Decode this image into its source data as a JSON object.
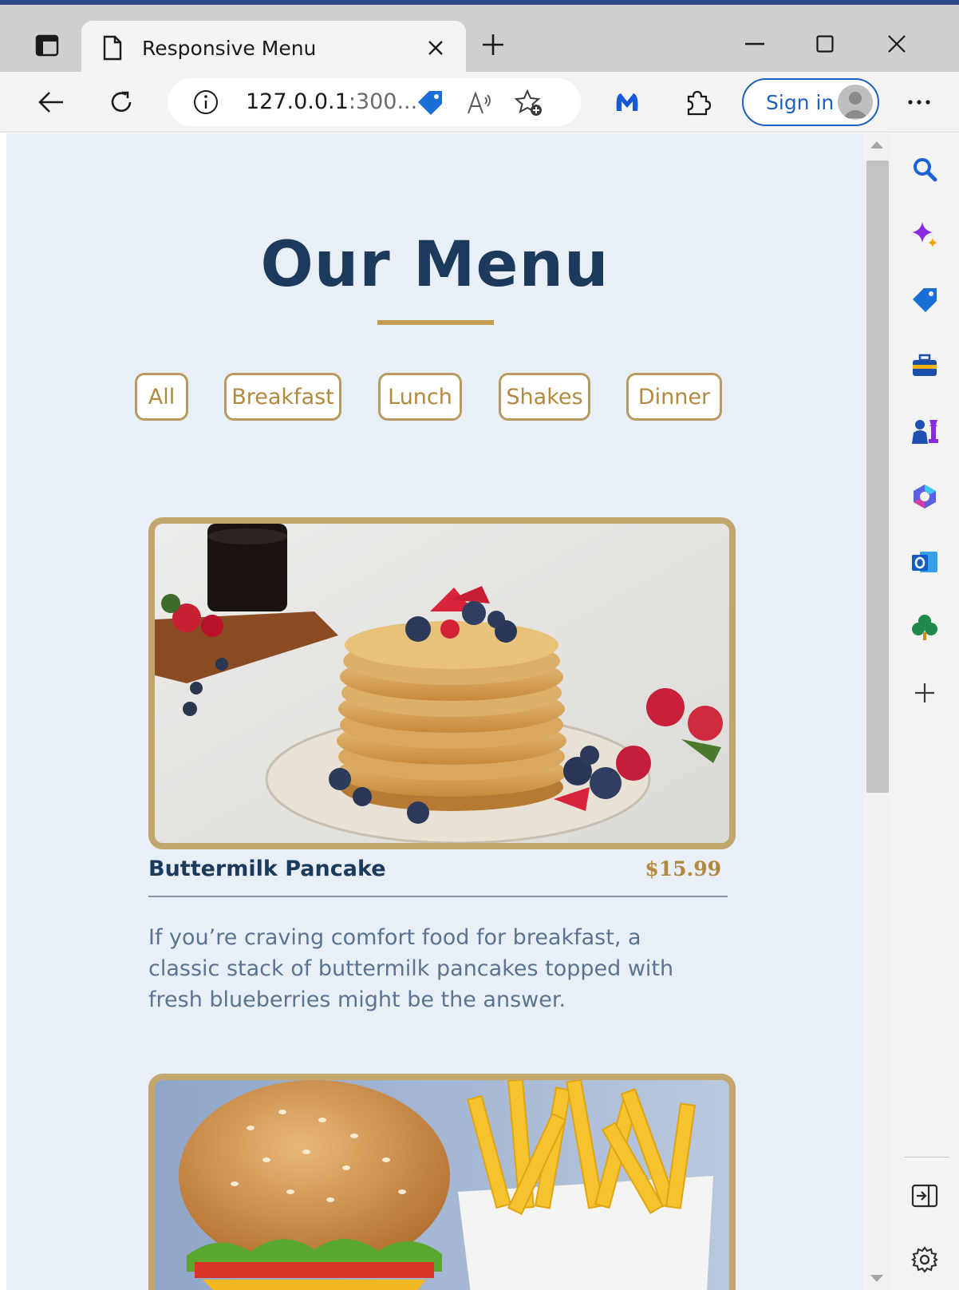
{
  "browser": {
    "tab_title": "Responsive Menu",
    "url_host": "127.0.0.1",
    "url_rest": ":300...",
    "signin_label": "Sign in"
  },
  "page": {
    "title": "Our Menu",
    "filters": [
      {
        "label": "All"
      },
      {
        "label": "Breakfast"
      },
      {
        "label": "Lunch"
      },
      {
        "label": "Shakes"
      },
      {
        "label": "Dinner"
      }
    ],
    "items": [
      {
        "name": "Buttermilk Pancake",
        "price": "$15.99",
        "description": "If you’re craving comfort food for breakfast, a classic stack of buttermilk pancakes topped with fresh blueberries might be the answer."
      }
    ]
  },
  "icons": {
    "side_panel": [
      "search-icon",
      "copilot-icon",
      "shopping-tag-icon",
      "tools-icon",
      "games-icon",
      "microsoft365-icon",
      "outlook-icon",
      "tree-icon",
      "add-icon",
      "panel-hide-icon",
      "settings-icon"
    ]
  },
  "colors": {
    "page_bg": "#e9eff7",
    "title": "#1b3a5c",
    "accent_gold": "#c29c4e",
    "filter_text": "#b1893f",
    "description": "#5a7390"
  }
}
